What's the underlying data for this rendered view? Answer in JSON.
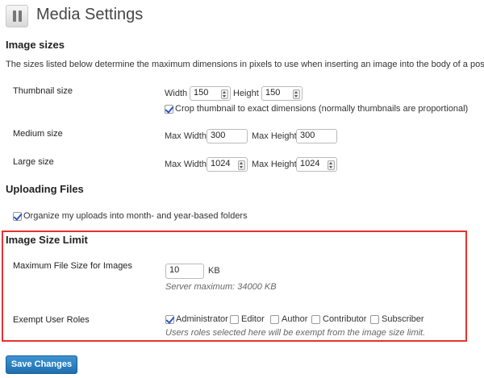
{
  "page": {
    "title": "Media Settings"
  },
  "image_sizes": {
    "heading": "Image sizes",
    "description": "The sizes listed below determine the maximum dimensions in pixels to use when inserting an image into the body of a post.",
    "thumbnail": {
      "label": "Thumbnail size",
      "width_label": "Width",
      "width": "150",
      "height_label": "Height",
      "height": "150",
      "crop_label": "Crop thumbnail to exact dimensions (normally thumbnails are proportional)"
    },
    "medium": {
      "label": "Medium size",
      "max_width_label": "Max Width",
      "max_width": "300",
      "max_height_label": "Max Height",
      "max_height": "300"
    },
    "large": {
      "label": "Large size",
      "max_width_label": "Max Width",
      "max_width": "1024",
      "max_height_label": "Max Height",
      "max_height": "1024"
    }
  },
  "uploading": {
    "heading": "Uploading Files",
    "organize_label": "Organize my uploads into month- and year-based folders"
  },
  "image_size_limit": {
    "heading": "Image Size Limit",
    "max_size_label": "Maximum File Size for Images",
    "max_size_value": "10",
    "unit": "KB",
    "server_max": "Server maximum: 34000 KB",
    "exempt_label": "Exempt User Roles",
    "roles": [
      "Administrator",
      "Editor",
      "Author",
      "Contributor",
      "Subscriber"
    ],
    "roles_help": "Users roles selected here will be exempt from the image size limit."
  },
  "actions": {
    "save_label": "Save Changes"
  },
  "colors": {
    "highlight_border": "#e5322d",
    "primary_button": "#2a7ec0",
    "checkbox_tick": "#2b57c4"
  }
}
